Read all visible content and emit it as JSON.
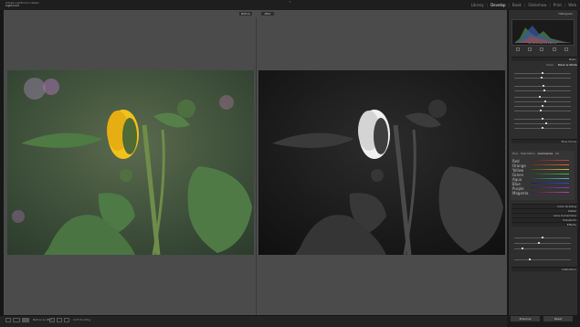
{
  "app": {
    "logo_line1": "Adobe Lightroom Classic",
    "logo_line2": "Lightroom"
  },
  "modules": [
    {
      "label": "Library",
      "active": false
    },
    {
      "label": "Develop",
      "active": true
    },
    {
      "label": "Book",
      "active": false
    },
    {
      "label": "Slideshow",
      "active": false
    },
    {
      "label": "Print",
      "active": false
    },
    {
      "label": "Web",
      "active": false
    }
  ],
  "view": {
    "before_label": "Before",
    "after_label": "After"
  },
  "right_panel": {
    "histogram_label": "Histogram",
    "histogram_readout": "ISO 100   50 mm   f/2.8   1/400 sec",
    "basic_header": "Basic",
    "treatment_color": "Color",
    "treatment_bw": "Black & White",
    "tone_curve_header": "Tone Curve",
    "hsl_tabs": [
      "Hue",
      "Saturation",
      "Luminance",
      "All"
    ],
    "hsl_colors": [
      "Red",
      "Orange",
      "Yellow",
      "Green",
      "Aqua",
      "Blue",
      "Purple",
      "Magenta"
    ],
    "panels": [
      "Color Grading",
      "Detail",
      "Lens Corrections",
      "Transform",
      "Effects",
      "Calibration"
    ],
    "previous_button": "Previous",
    "reset_button": "Reset"
  },
  "bottom": {
    "view_label": "Before & After :",
    "soft_proof": "Soft Proofing"
  },
  "colors": {
    "accent": "#e9e9e9",
    "panel_bg": "#2e2e2e",
    "view_bg": "#4b4b4b",
    "petal_yellow": "#f2c21a"
  }
}
